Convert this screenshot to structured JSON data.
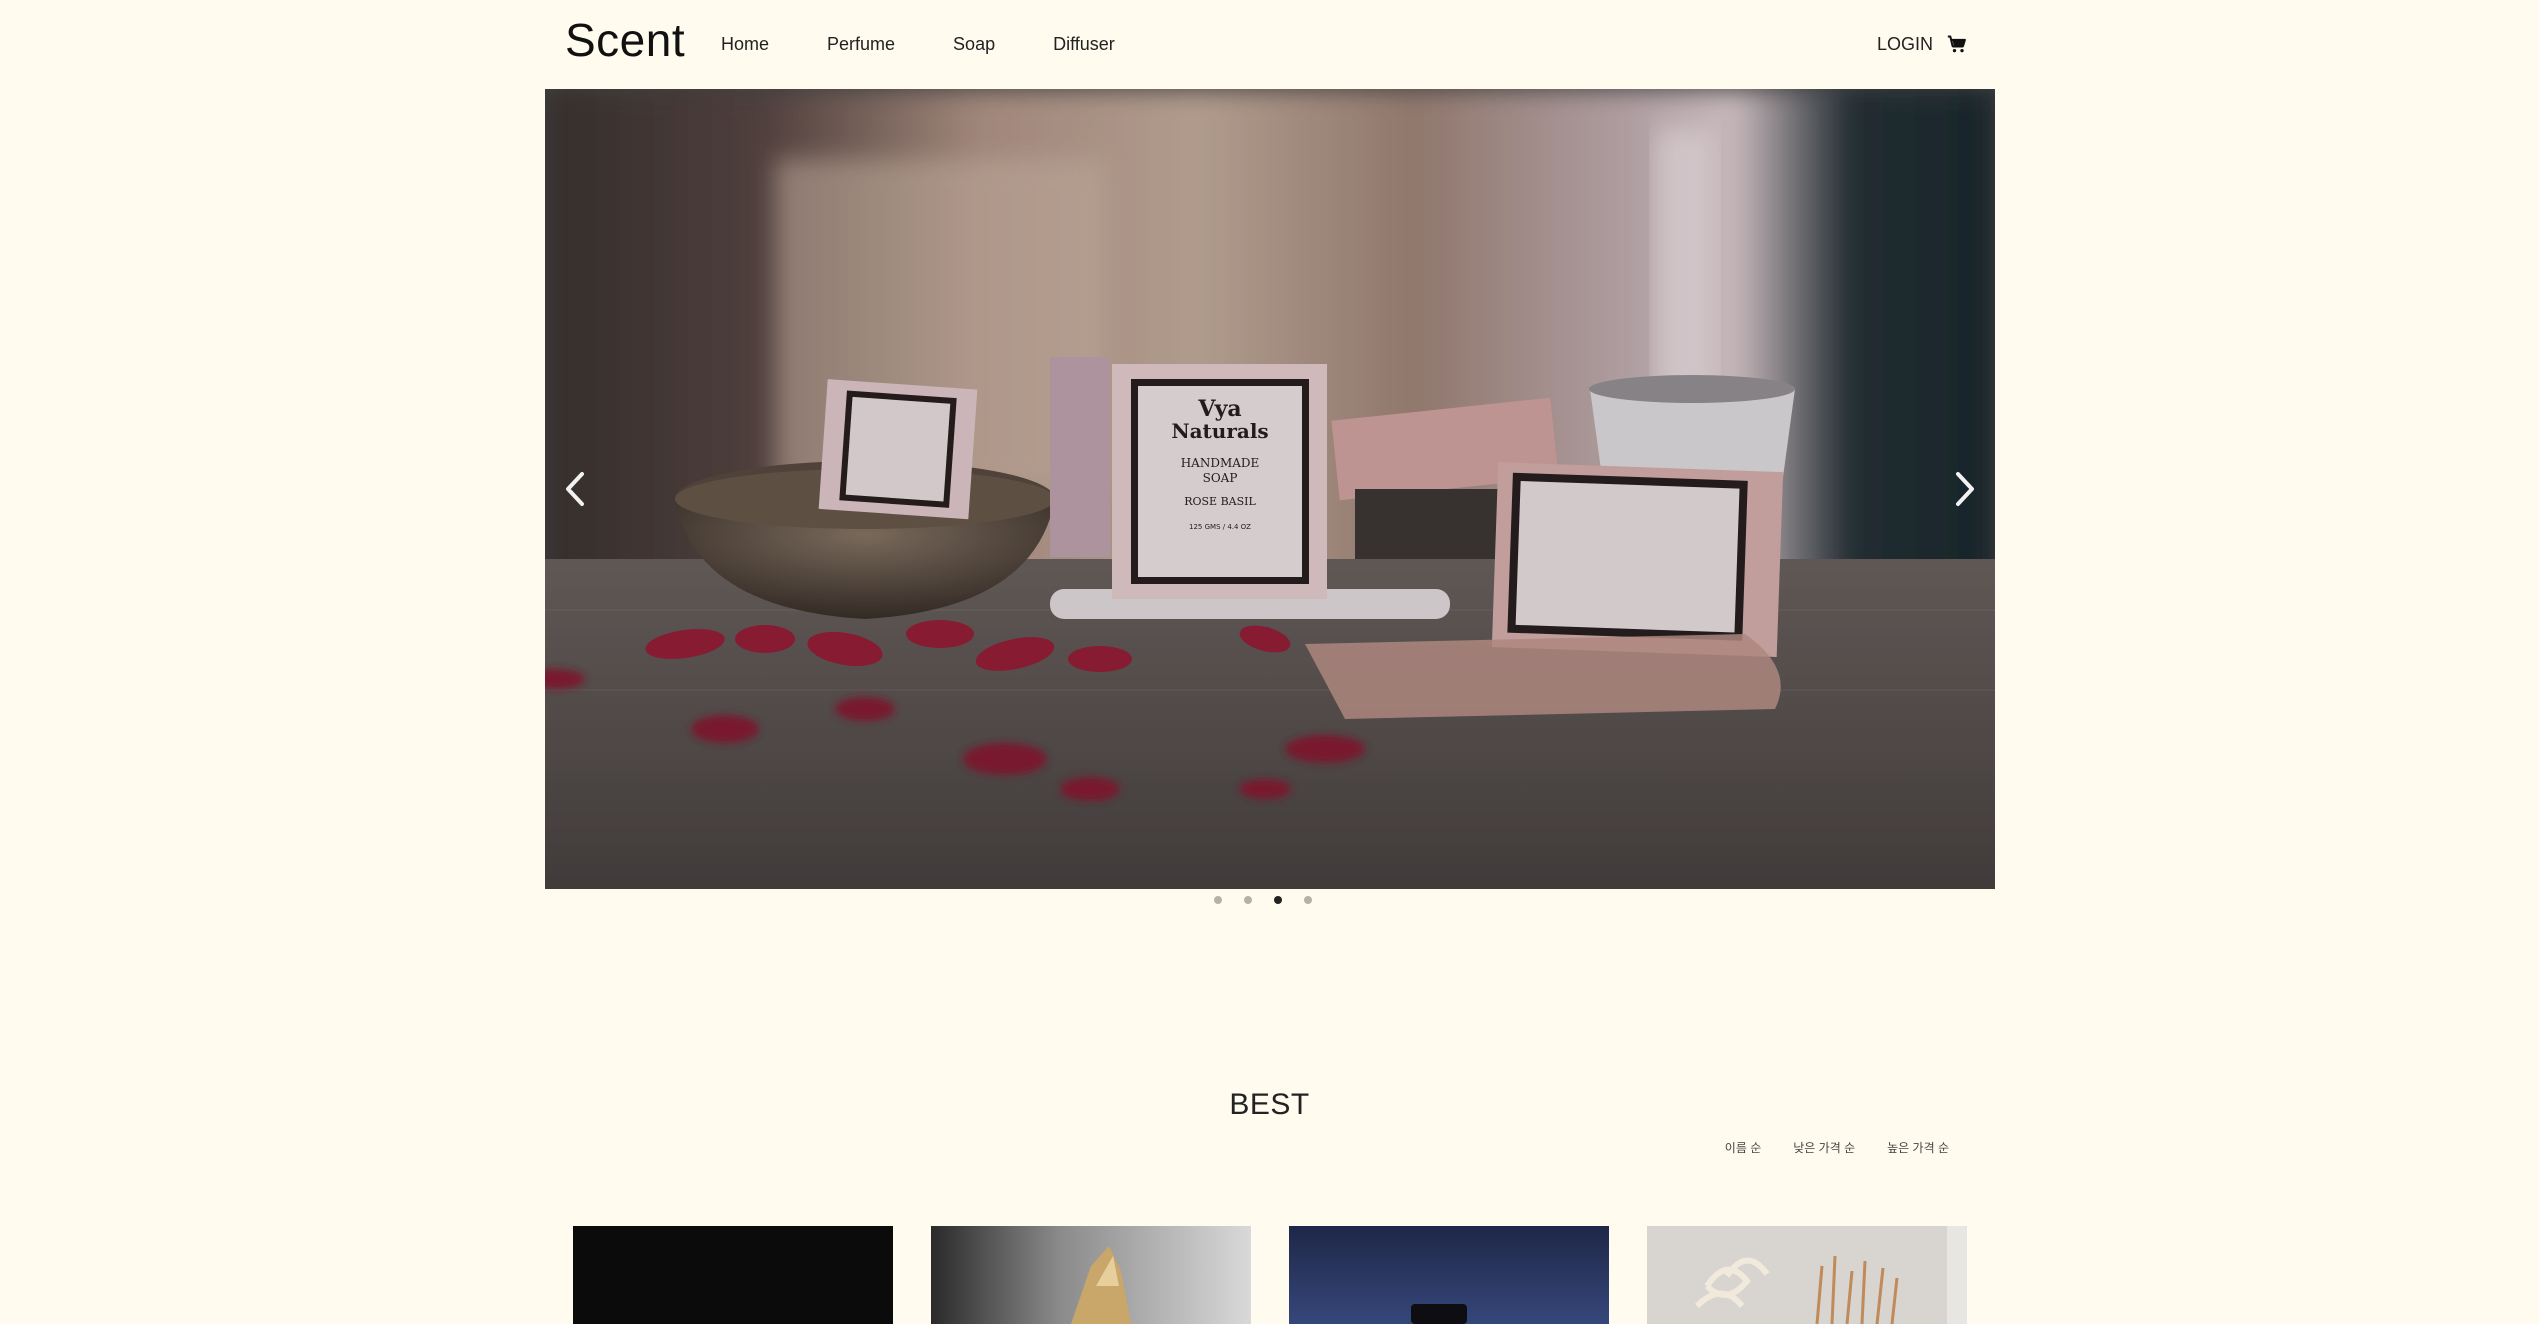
{
  "header": {
    "logo": "Scent",
    "nav": [
      {
        "label": "Home"
      },
      {
        "label": "Perfume"
      },
      {
        "label": "Soap"
      },
      {
        "label": "Diffuser"
      }
    ],
    "login": "LOGIN",
    "cart_icon": "cart-icon"
  },
  "carousel": {
    "slide_count": 4,
    "active_index": 2,
    "slide_text": {
      "brand_line1": "Vya",
      "brand_line2": "Naturals",
      "product_line1": "HANDMADE",
      "product_line2": "SOAP",
      "variant": "ROSE BASIL",
      "weight": "125 GMS / 4.4 OZ"
    }
  },
  "best": {
    "title": "BEST",
    "sort_options": [
      {
        "label": "이름 순"
      },
      {
        "label": "낮은 가격 순"
      },
      {
        "label": "높은 가격 순"
      }
    ]
  },
  "colors": {
    "background": "#fffcef",
    "text": "#222222",
    "dot_inactive": "#b5b2a5",
    "dot_active": "#222222"
  }
}
